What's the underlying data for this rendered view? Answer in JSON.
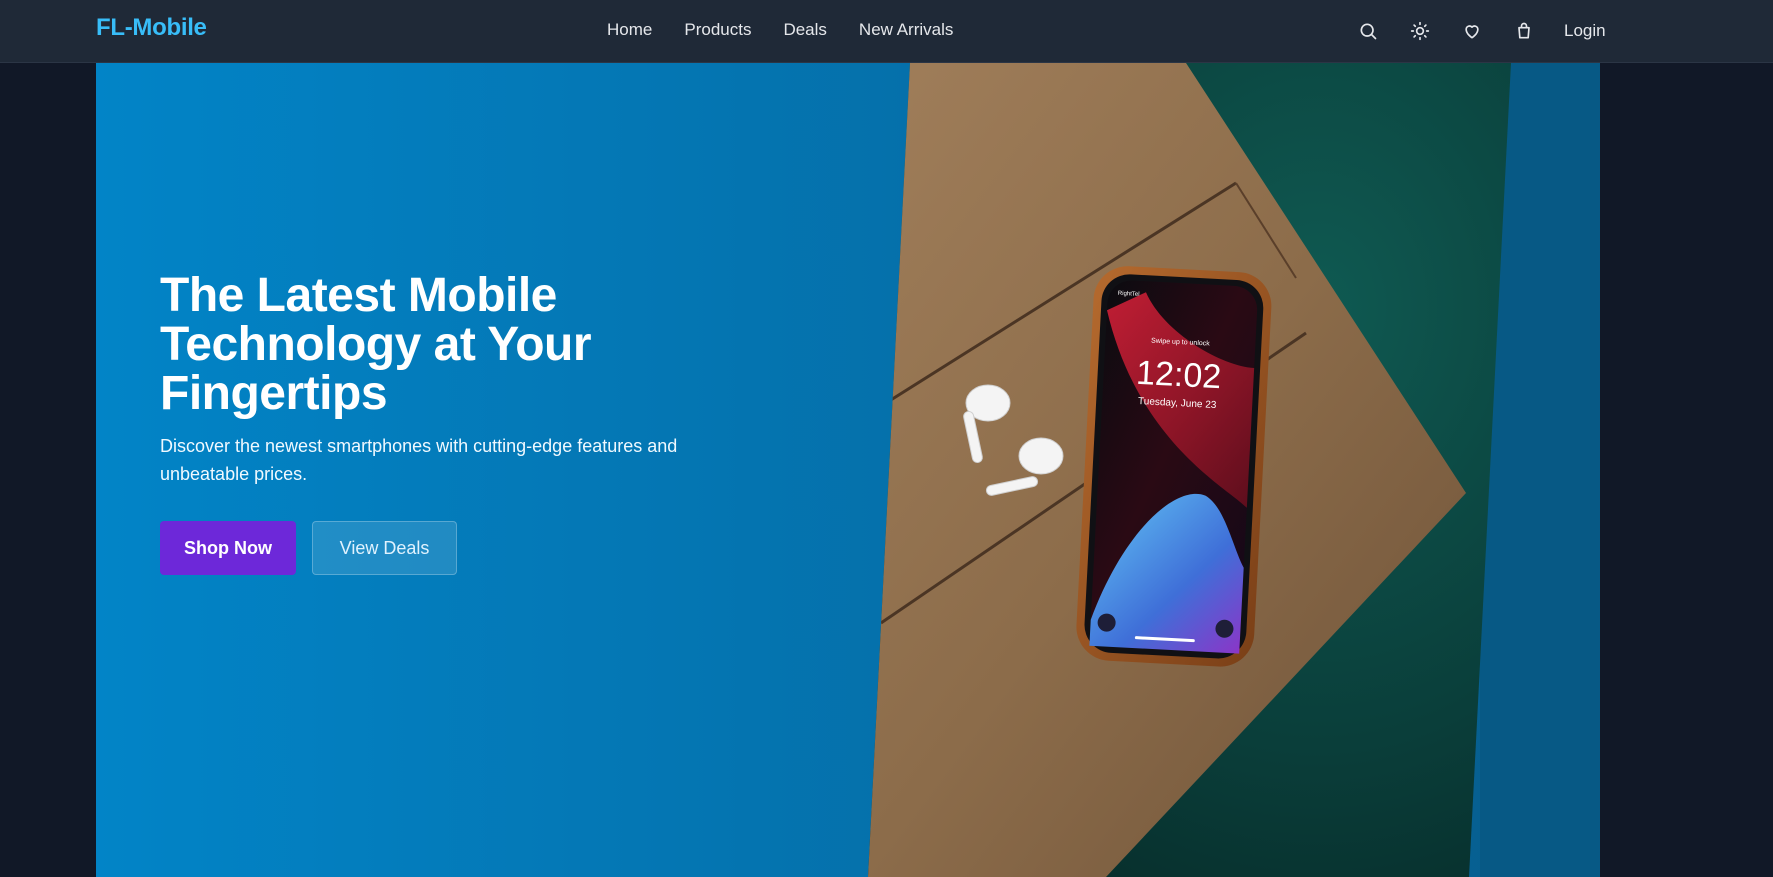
{
  "brand": {
    "name": "FL-Mobile"
  },
  "nav": {
    "links": [
      "Home",
      "Products",
      "Deals",
      "New Arrivals"
    ],
    "icons": [
      "search-icon",
      "sun-icon",
      "heart-icon",
      "shopping-bag-icon"
    ],
    "login_label": "Login"
  },
  "hero": {
    "title": "The Latest Mobile Technology at Your Fingertips",
    "subtitle": "Discover the newest smartphones with cutting-edge features and unbeatable prices.",
    "primary_button": "Shop Now",
    "secondary_button": "View Deals",
    "image": {
      "description_icon": "phone-with-earbuds-photo",
      "phone_time": "12:02",
      "phone_date": "Tuesday, June 23",
      "phone_lock_text": "Swipe up to unlock",
      "phone_carrier": "RightTel"
    }
  },
  "colors": {
    "nav_bg": "#1f2937",
    "page_bg": "#111827",
    "brand_accent": "#38bdf8",
    "hero_blue": "#0284c7",
    "primary_button": "#6d28d9"
  }
}
